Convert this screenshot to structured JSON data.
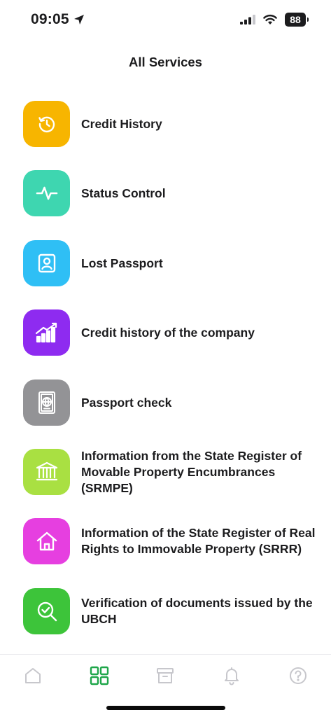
{
  "status_bar": {
    "time": "09:05",
    "battery": "88"
  },
  "header": {
    "title": "All Services"
  },
  "services": [
    {
      "label": "Credit History",
      "icon": "history-clock-icon",
      "color": "#F7B500"
    },
    {
      "label": "Status Control",
      "icon": "pulse-icon",
      "color": "#3ED6B0"
    },
    {
      "label": "Lost Passport",
      "icon": "person-badge-icon",
      "color": "#2FBFF5"
    },
    {
      "label": "Credit history of the company",
      "icon": "growth-chart-icon",
      "color": "#8E2BF0"
    },
    {
      "label": "Passport check",
      "icon": "passport-icon",
      "color": "#939396"
    },
    {
      "label": "Information from the State Register of Movable Property Encumbrances (SRMPE)",
      "icon": "bank-building-icon",
      "color": "#A9E042"
    },
    {
      "label": "Information of the State Register of Real Rights to Immovable Property (SRRR)",
      "icon": "house-icon",
      "color": "#E63FE0"
    },
    {
      "label": "Verification of documents issued by the UBCH",
      "icon": "magnifier-check-icon",
      "color": "#3DC43A"
    }
  ],
  "tab_bar": {
    "active_color": "#1FA64A",
    "inactive_color": "#c7c7cc",
    "tabs": [
      {
        "id": "home",
        "icon": "home-icon",
        "active": false
      },
      {
        "id": "services",
        "icon": "grid-icon",
        "active": true
      },
      {
        "id": "archive",
        "icon": "archive-box-icon",
        "active": false
      },
      {
        "id": "notifications",
        "icon": "bell-icon",
        "active": false
      },
      {
        "id": "help",
        "icon": "help-circle-icon",
        "active": false
      }
    ]
  }
}
